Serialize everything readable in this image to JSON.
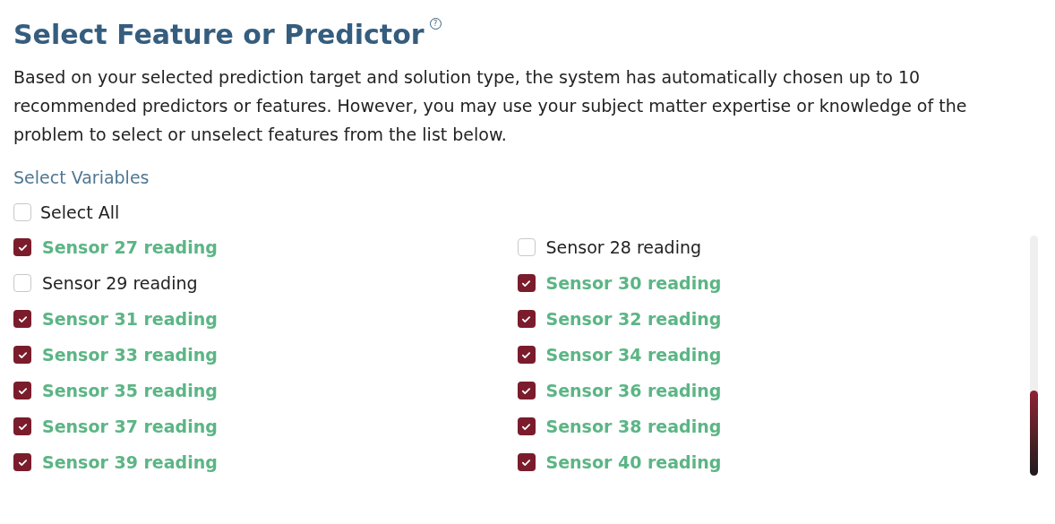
{
  "title": "Select Feature or Predictor",
  "help_icon": "?",
  "description": "Based on your selected prediction target and solution type, the system has automatically chosen up to 10 recommended predictors or features. However, you may use your subject matter expertise or knowledge of the problem to select or unselect features from the list below.",
  "section_label": "Select Variables",
  "select_all": {
    "label": "Select All",
    "checked": false
  },
  "variables": [
    {
      "label": "Sensor 27 reading",
      "checked": true
    },
    {
      "label": "Sensor 28 reading",
      "checked": false
    },
    {
      "label": "Sensor 29 reading",
      "checked": false
    },
    {
      "label": "Sensor 30 reading",
      "checked": true
    },
    {
      "label": "Sensor 31 reading",
      "checked": true
    },
    {
      "label": "Sensor 32 reading",
      "checked": true
    },
    {
      "label": "Sensor 33 reading",
      "checked": true
    },
    {
      "label": "Sensor 34 reading",
      "checked": true
    },
    {
      "label": "Sensor 35 reading",
      "checked": true
    },
    {
      "label": "Sensor 36 reading",
      "checked": true
    },
    {
      "label": "Sensor 37 reading",
      "checked": true
    },
    {
      "label": "Sensor 38 reading",
      "checked": true
    },
    {
      "label": "Sensor 39 reading",
      "checked": true
    },
    {
      "label": "Sensor 40 reading",
      "checked": true
    }
  ]
}
